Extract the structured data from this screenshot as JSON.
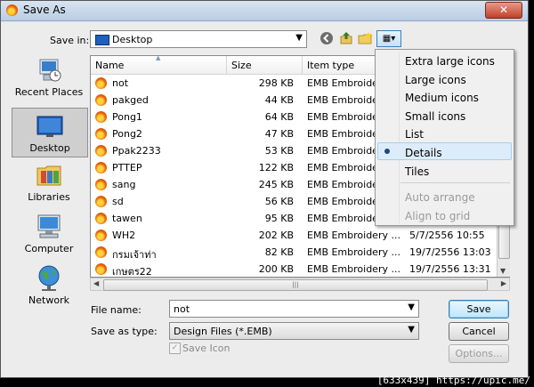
{
  "window": {
    "title": "Save As",
    "close_glyph": "✕"
  },
  "toolbar": {
    "save_in_label": "Save in:",
    "save_in_value": "Desktop",
    "icons": [
      "back-icon",
      "up-folder-icon",
      "new-folder-icon",
      "views-icon"
    ]
  },
  "places": [
    {
      "label": "Recent Places",
      "icon": "recent-places-icon"
    },
    {
      "label": "Desktop",
      "icon": "desktop-icon",
      "selected": true
    },
    {
      "label": "Libraries",
      "icon": "libraries-icon"
    },
    {
      "label": "Computer",
      "icon": "computer-icon"
    },
    {
      "label": "Network",
      "icon": "network-icon"
    }
  ],
  "columns": {
    "name": "Name",
    "size": "Size",
    "type": "Item type",
    "sort_glyph": "▲"
  },
  "files": [
    {
      "name": "not",
      "size": "298 KB",
      "type": "EMB Embroide",
      "date": ""
    },
    {
      "name": "pakged",
      "size": "44 KB",
      "type": "EMB Embroide",
      "date": ""
    },
    {
      "name": "Pong1",
      "size": "64 KB",
      "type": "EMB Embroide",
      "date": ""
    },
    {
      "name": "Pong2",
      "size": "47 KB",
      "type": "EMB Embroide",
      "date": ""
    },
    {
      "name": "Ppak2233",
      "size": "53 KB",
      "type": "EMB Embroide",
      "date": ""
    },
    {
      "name": "PTTEP",
      "size": "122 KB",
      "type": "EMB Embroide",
      "date": ""
    },
    {
      "name": "sang",
      "size": "245 KB",
      "type": "EMB Embroide",
      "date": ""
    },
    {
      "name": "sd",
      "size": "56 KB",
      "type": "EMB Embroide",
      "date": ""
    },
    {
      "name": "tawen",
      "size": "95 KB",
      "type": "EMB Embroide",
      "date": ""
    },
    {
      "name": "WH2",
      "size": "202 KB",
      "type": "EMB Embroidery ...",
      "date": "5/7/2556 10:55"
    },
    {
      "name": "กรมเจ้าท่า",
      "size": "82 KB",
      "type": "EMB Embroidery ...",
      "date": "19/7/2556 13:03"
    },
    {
      "name": "เกษตร22",
      "size": "200 KB",
      "type": "EMB Embroidery ...",
      "date": "19/7/2556 13:31"
    }
  ],
  "form": {
    "filename_label": "File name:",
    "filename_value": "not",
    "type_label": "Save as type:",
    "type_value": "Design Files (*.EMB)",
    "save_icon_label": "Save Icon",
    "save_icon_checked": true
  },
  "buttons": {
    "save": "Save",
    "cancel": "Cancel",
    "options": "Options..."
  },
  "view_menu": {
    "items": [
      "Extra large icons",
      "Large icons",
      "Medium icons",
      "Small icons",
      "List",
      "Details",
      "Tiles"
    ],
    "selected": "Details",
    "disabled_items": [
      "Auto arrange",
      "Align to grid"
    ]
  },
  "watermark": "[633x439] https://upic.me/"
}
